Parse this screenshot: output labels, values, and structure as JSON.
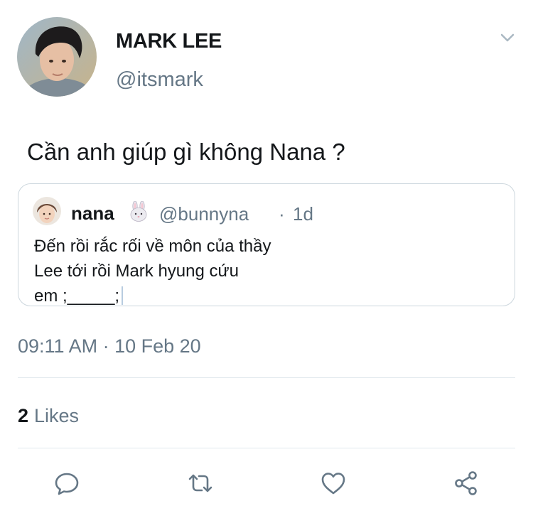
{
  "author": {
    "display_name": "MARK LEE",
    "handle": "@itsmark"
  },
  "tweet": {
    "text": "Cần anh giúp gì không Nana ?"
  },
  "quoted_tweet": {
    "display_name": "nana",
    "emoji": "rabbit-face",
    "handle": "@bunnyna",
    "separator": "·",
    "time": "1d",
    "lines": [
      "Đến rồi rắc rối về môn của thầy",
      "Lee tới rồi Mark hyung cứu",
      "em ;_____;"
    ]
  },
  "meta": {
    "timestamp": "09:11 AM · 10 Feb 20",
    "likes_count": "2",
    "likes_label": "Likes"
  },
  "actions": [
    "reply-icon",
    "retweet-icon",
    "like-icon",
    "share-icon"
  ],
  "colors": {
    "text_primary": "#14171a",
    "text_secondary": "#657786",
    "border": "#ccd6dd",
    "divider": "#e1e8ed"
  }
}
